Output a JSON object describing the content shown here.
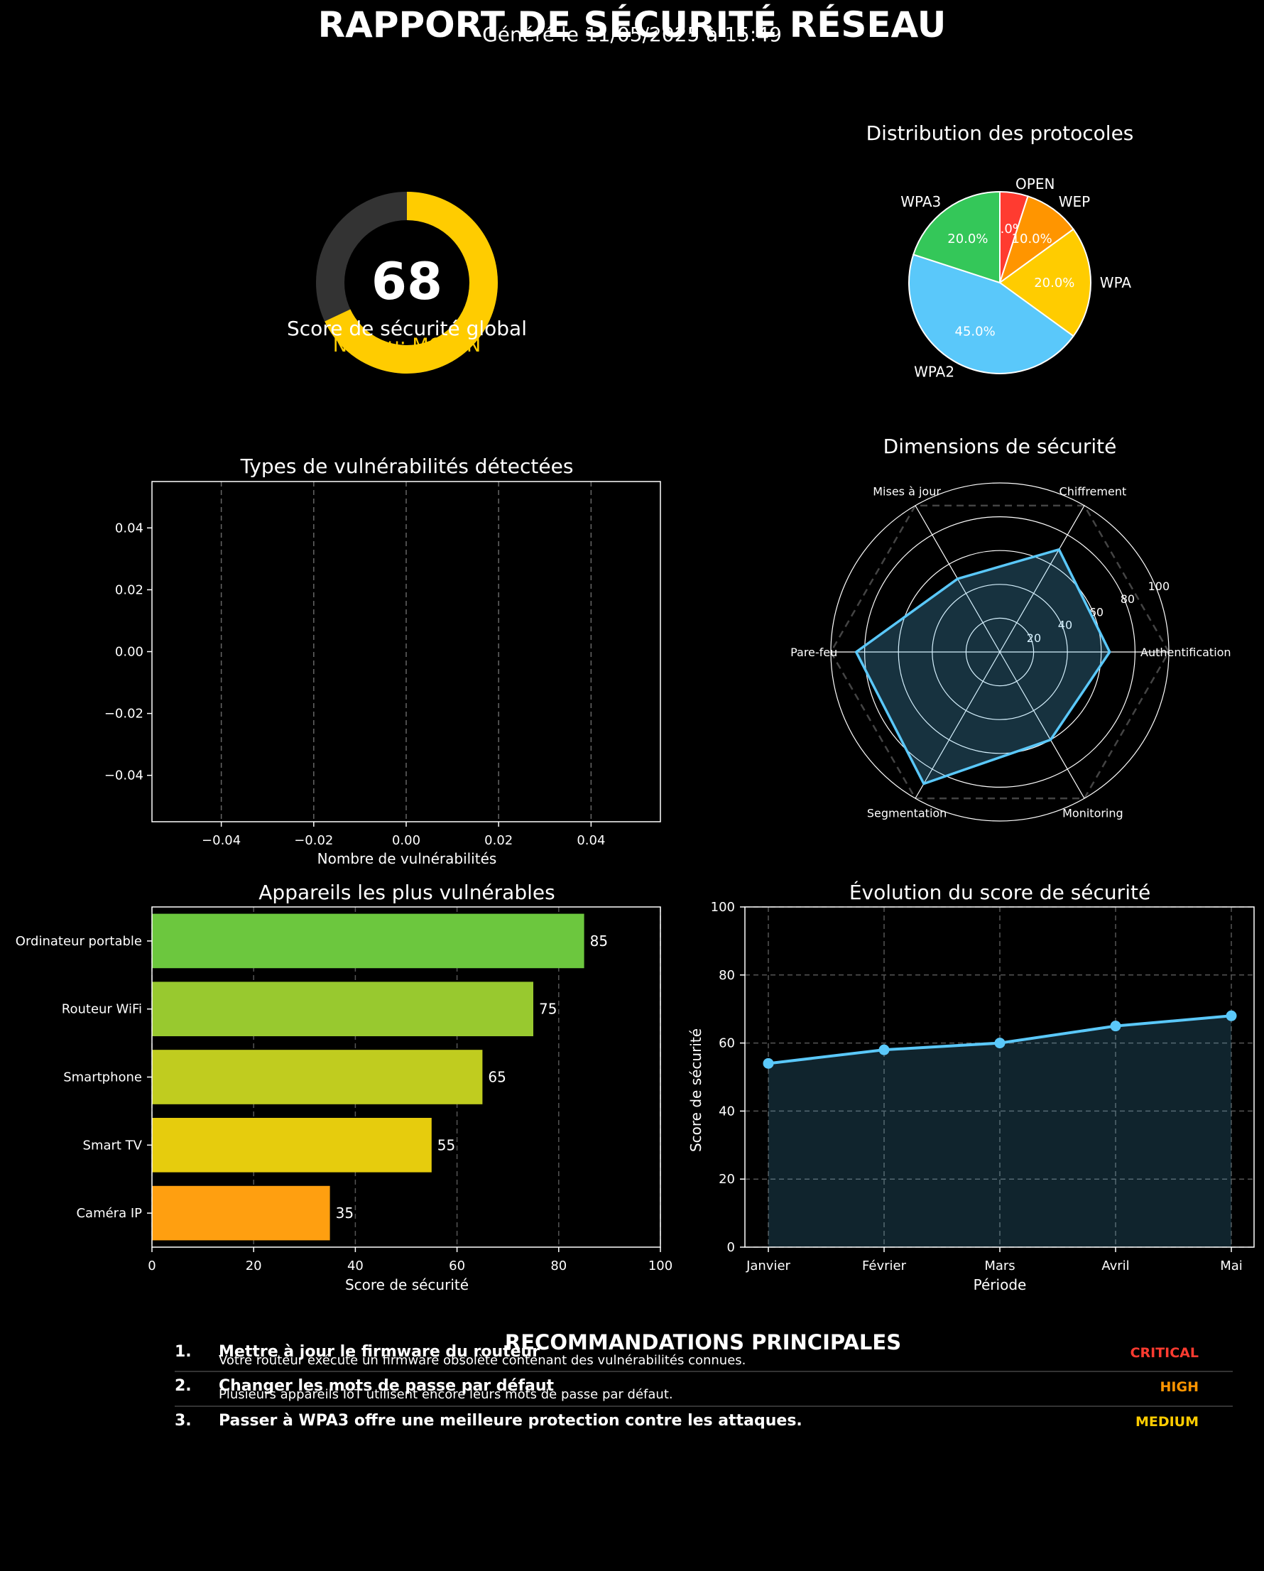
{
  "header": {
    "title": "RAPPORT DE SÉCURITÉ RÉSEAU",
    "subtitle": "Généré le 11/05/2025 à 15:49"
  },
  "colors": {
    "background": "#000000",
    "yellow": "#ffcc00",
    "blue": "#5ac8fa",
    "green": "#34c759",
    "orange": "#ff9500",
    "red": "#ff3b30",
    "gauge_track": "#333333"
  },
  "chart_data": [
    {
      "id": "gauge",
      "type": "gauge",
      "value": 68,
      "max": 100,
      "label": "Score de sécurité global",
      "level": "Niveau: MOYEN"
    },
    {
      "id": "protocols",
      "type": "pie",
      "title": "Distribution des protocoles",
      "slices": [
        {
          "label": "OPEN",
          "value": 5.0,
          "pct": "5.0%",
          "color": "#ff3b30"
        },
        {
          "label": "WEP",
          "value": 10.0,
          "pct": "10.0%",
          "color": "#ff9500"
        },
        {
          "label": "WPA",
          "value": 20.0,
          "pct": "20.0%",
          "color": "#ffcc00"
        },
        {
          "label": "WPA2",
          "value": 45.0,
          "pct": "45.0%",
          "color": "#5ac8fa"
        },
        {
          "label": "WPA3",
          "value": 20.0,
          "pct": "20.0%",
          "color": "#34c759"
        }
      ]
    },
    {
      "id": "vulns",
      "type": "bar",
      "title": "Types de vulnérabilités détectées",
      "xlabel": "Nombre de vulnérabilités",
      "ylabel": "",
      "categories": [],
      "values": [],
      "xlim": [
        -0.055,
        0.055
      ],
      "ylim": [
        -0.055,
        0.055
      ],
      "xticks": [
        -0.04,
        -0.02,
        0.0,
        0.02,
        0.04
      ],
      "xtick_labels": [
        "−0.04",
        "−0.02",
        "0.00",
        "0.02",
        "0.04"
      ],
      "yticks": [
        0.04,
        0.02,
        0.0,
        -0.02,
        -0.04
      ],
      "ytick_labels": [
        "0.04",
        "0.02",
        "0.00",
        "−0.02",
        "−0.04"
      ],
      "grid": "x, dashed"
    },
    {
      "id": "radar",
      "type": "radar",
      "title": "Dimensions de sécurité",
      "axes": [
        "Authentification",
        "Chiffrement",
        "Mises à jour",
        "Pare-feu",
        "Segmentation",
        "Monitoring"
      ],
      "values": [
        65,
        70,
        50,
        85,
        90,
        60
      ],
      "reference": [
        100,
        100,
        100,
        100,
        100,
        100
      ],
      "rlim": [
        0,
        100
      ],
      "rticks": [
        20,
        40,
        60,
        80,
        100
      ]
    },
    {
      "id": "devices",
      "type": "bar",
      "orientation": "horizontal",
      "title": "Appareils les plus vulnérables",
      "xlabel": "Score de sécurité",
      "ylabel": "",
      "categories": [
        "Ordinateur portable",
        "Routeur WiFi",
        "Smartphone",
        "Smart TV",
        "Caméra IP"
      ],
      "values": [
        85,
        75,
        65,
        55,
        35
      ],
      "colors": [
        "#6cc73e",
        "#98c92f",
        "#c0cc1f",
        "#e6cc0d",
        "#ff9f10"
      ],
      "xlim": [
        0,
        100
      ],
      "xticks": [
        0,
        20,
        40,
        60,
        80,
        100
      ],
      "grid": "x, dashed"
    },
    {
      "id": "evolution",
      "type": "area",
      "title": "Évolution du score de sécurité",
      "xlabel": "Période",
      "ylabel": "Score de sécurité",
      "categories": [
        "Janvier",
        "Février",
        "Mars",
        "Avril",
        "Mai"
      ],
      "values": [
        54,
        58,
        60,
        65,
        68
      ],
      "ylim": [
        0,
        100
      ],
      "yticks": [
        0,
        20,
        40,
        60,
        80,
        100
      ],
      "grid": "both, dashed"
    }
  ],
  "recommendations": {
    "heading": "RECOMMANDATIONS PRINCIPALES",
    "items": [
      {
        "num": "1.",
        "title": "Mettre à jour le firmware du routeur",
        "desc": "Votre routeur exécute un firmware obsolète contenant des vulnérabilités connues.",
        "severity": "CRITICAL",
        "color": "#ff3b30"
      },
      {
        "num": "2.",
        "title": "Changer les mots de passe par défaut",
        "desc": "Plusieurs appareils IoT utilisent encore leurs mots de passe par défaut.",
        "severity": "HIGH",
        "color": "#ff9500"
      },
      {
        "num": "3.",
        "title": "Passer à WPA3 offre une meilleure protection contre les attaques.",
        "desc": "",
        "severity": "MEDIUM",
        "color": "#ffcc00"
      }
    ]
  }
}
